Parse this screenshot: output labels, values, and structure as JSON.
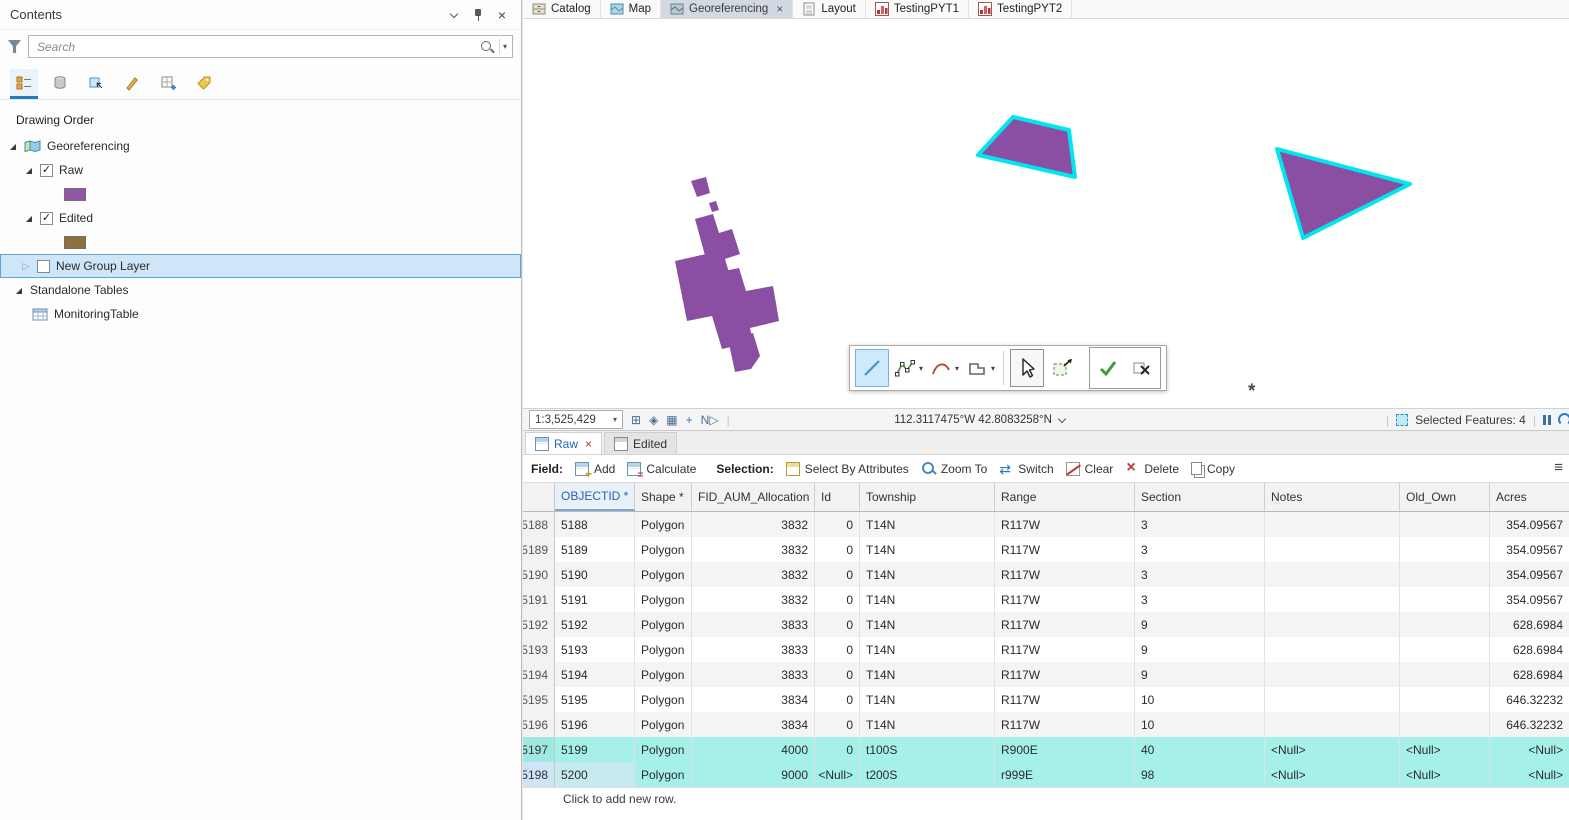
{
  "contents": {
    "title": "Contents",
    "search": {
      "placeholder": "Search"
    },
    "drawing_order_label": "Drawing Order",
    "tree": {
      "map_name": "Georeferencing",
      "layers": [
        {
          "name": "Raw",
          "checked": true,
          "swatch_color": "#9256a4"
        },
        {
          "name": "Edited",
          "checked": true,
          "swatch_color": "#8e6f3e"
        },
        {
          "name": "New Group Layer",
          "checked": false,
          "selected": true
        }
      ],
      "standalone_tables_label": "Standalone Tables",
      "tables": [
        {
          "name": "MonitoringTable"
        }
      ]
    }
  },
  "view_tabs": {
    "tabs": [
      {
        "label": "Catalog",
        "active": false
      },
      {
        "label": "Map",
        "active": false
      },
      {
        "label": "Georeferencing",
        "active": true
      },
      {
        "label": "Layout",
        "active": false
      },
      {
        "label": "TestingPYT1",
        "active": false
      },
      {
        "label": "TestingPYT2",
        "active": false
      }
    ]
  },
  "map": {
    "colors": {
      "polygon_fill": "#8a4fa3",
      "selection_outline": "#00e6ef"
    },
    "status_bar": {
      "scale": "1:3,525,429",
      "coordinates": "112.3117475°W 42.8083258°N",
      "selected_features": "Selected Features: 4"
    }
  },
  "table_panel": {
    "tabs": [
      {
        "label": "Raw",
        "active": true
      },
      {
        "label": "Edited",
        "active": false
      }
    ],
    "toolbar": {
      "field_label": "Field:",
      "add": "Add",
      "calculate": "Calculate",
      "selection_label": "Selection:",
      "select_by_attributes": "Select By Attributes",
      "zoom_to": "Zoom To",
      "switch": "Switch",
      "clear": "Clear",
      "delete": "Delete",
      "copy": "Copy"
    },
    "columns": [
      "OBJECTID *",
      "Shape *",
      "FID_AUM_Allocation",
      "Id",
      "Township",
      "Range",
      "Section",
      "Notes",
      "Old_Own",
      "Acres"
    ],
    "rows": [
      {
        "num": "5188",
        "objectid": "5188",
        "shape": "Polygon",
        "fid": "3832",
        "id": "0",
        "township": "T14N",
        "range": "R117W",
        "section": "3",
        "notes": "",
        "old_own": "",
        "acres": "354.09567",
        "selected": false
      },
      {
        "num": "5189",
        "objectid": "5189",
        "shape": "Polygon",
        "fid": "3832",
        "id": "0",
        "township": "T14N",
        "range": "R117W",
        "section": "3",
        "notes": "",
        "old_own": "",
        "acres": "354.09567",
        "selected": false
      },
      {
        "num": "5190",
        "objectid": "5190",
        "shape": "Polygon",
        "fid": "3832",
        "id": "0",
        "township": "T14N",
        "range": "R117W",
        "section": "3",
        "notes": "",
        "old_own": "",
        "acres": "354.09567",
        "selected": false
      },
      {
        "num": "5191",
        "objectid": "5191",
        "shape": "Polygon",
        "fid": "3832",
        "id": "0",
        "township": "T14N",
        "range": "R117W",
        "section": "3",
        "notes": "",
        "old_own": "",
        "acres": "354.09567",
        "selected": false
      },
      {
        "num": "5192",
        "objectid": "5192",
        "shape": "Polygon",
        "fid": "3833",
        "id": "0",
        "township": "T14N",
        "range": "R117W",
        "section": "9",
        "notes": "",
        "old_own": "",
        "acres": "628.6984",
        "selected": false
      },
      {
        "num": "5193",
        "objectid": "5193",
        "shape": "Polygon",
        "fid": "3833",
        "id": "0",
        "township": "T14N",
        "range": "R117W",
        "section": "9",
        "notes": "",
        "old_own": "",
        "acres": "628.6984",
        "selected": false
      },
      {
        "num": "5194",
        "objectid": "5194",
        "shape": "Polygon",
        "fid": "3833",
        "id": "0",
        "township": "T14N",
        "range": "R117W",
        "section": "9",
        "notes": "",
        "old_own": "",
        "acres": "628.6984",
        "selected": false
      },
      {
        "num": "5195",
        "objectid": "5195",
        "shape": "Polygon",
        "fid": "3834",
        "id": "0",
        "township": "T14N",
        "range": "R117W",
        "section": "10",
        "notes": "",
        "old_own": "",
        "acres": "646.32232",
        "selected": false
      },
      {
        "num": "5196",
        "objectid": "5196",
        "shape": "Polygon",
        "fid": "3834",
        "id": "0",
        "township": "T14N",
        "range": "R117W",
        "section": "10",
        "notes": "",
        "old_own": "",
        "acres": "646.32232",
        "selected": false
      },
      {
        "num": "5197",
        "objectid": "5199",
        "shape": "Polygon",
        "fid": "4000",
        "id": "0",
        "township": "t100S",
        "range": "R900E",
        "section": "40",
        "notes": "<Null>",
        "old_own": "<Null>",
        "acres": "<Null>",
        "selected": true
      },
      {
        "num": "5198",
        "objectid": "5200",
        "shape": "Polygon",
        "fid": "9000",
        "id": "<Null>",
        "township": "t200S",
        "range": "r999E",
        "section": "98",
        "notes": "<Null>",
        "old_own": "<Null>",
        "acres": "<Null>",
        "selected": true,
        "active": true
      }
    ],
    "add_row_hint": "Click to add new row."
  }
}
